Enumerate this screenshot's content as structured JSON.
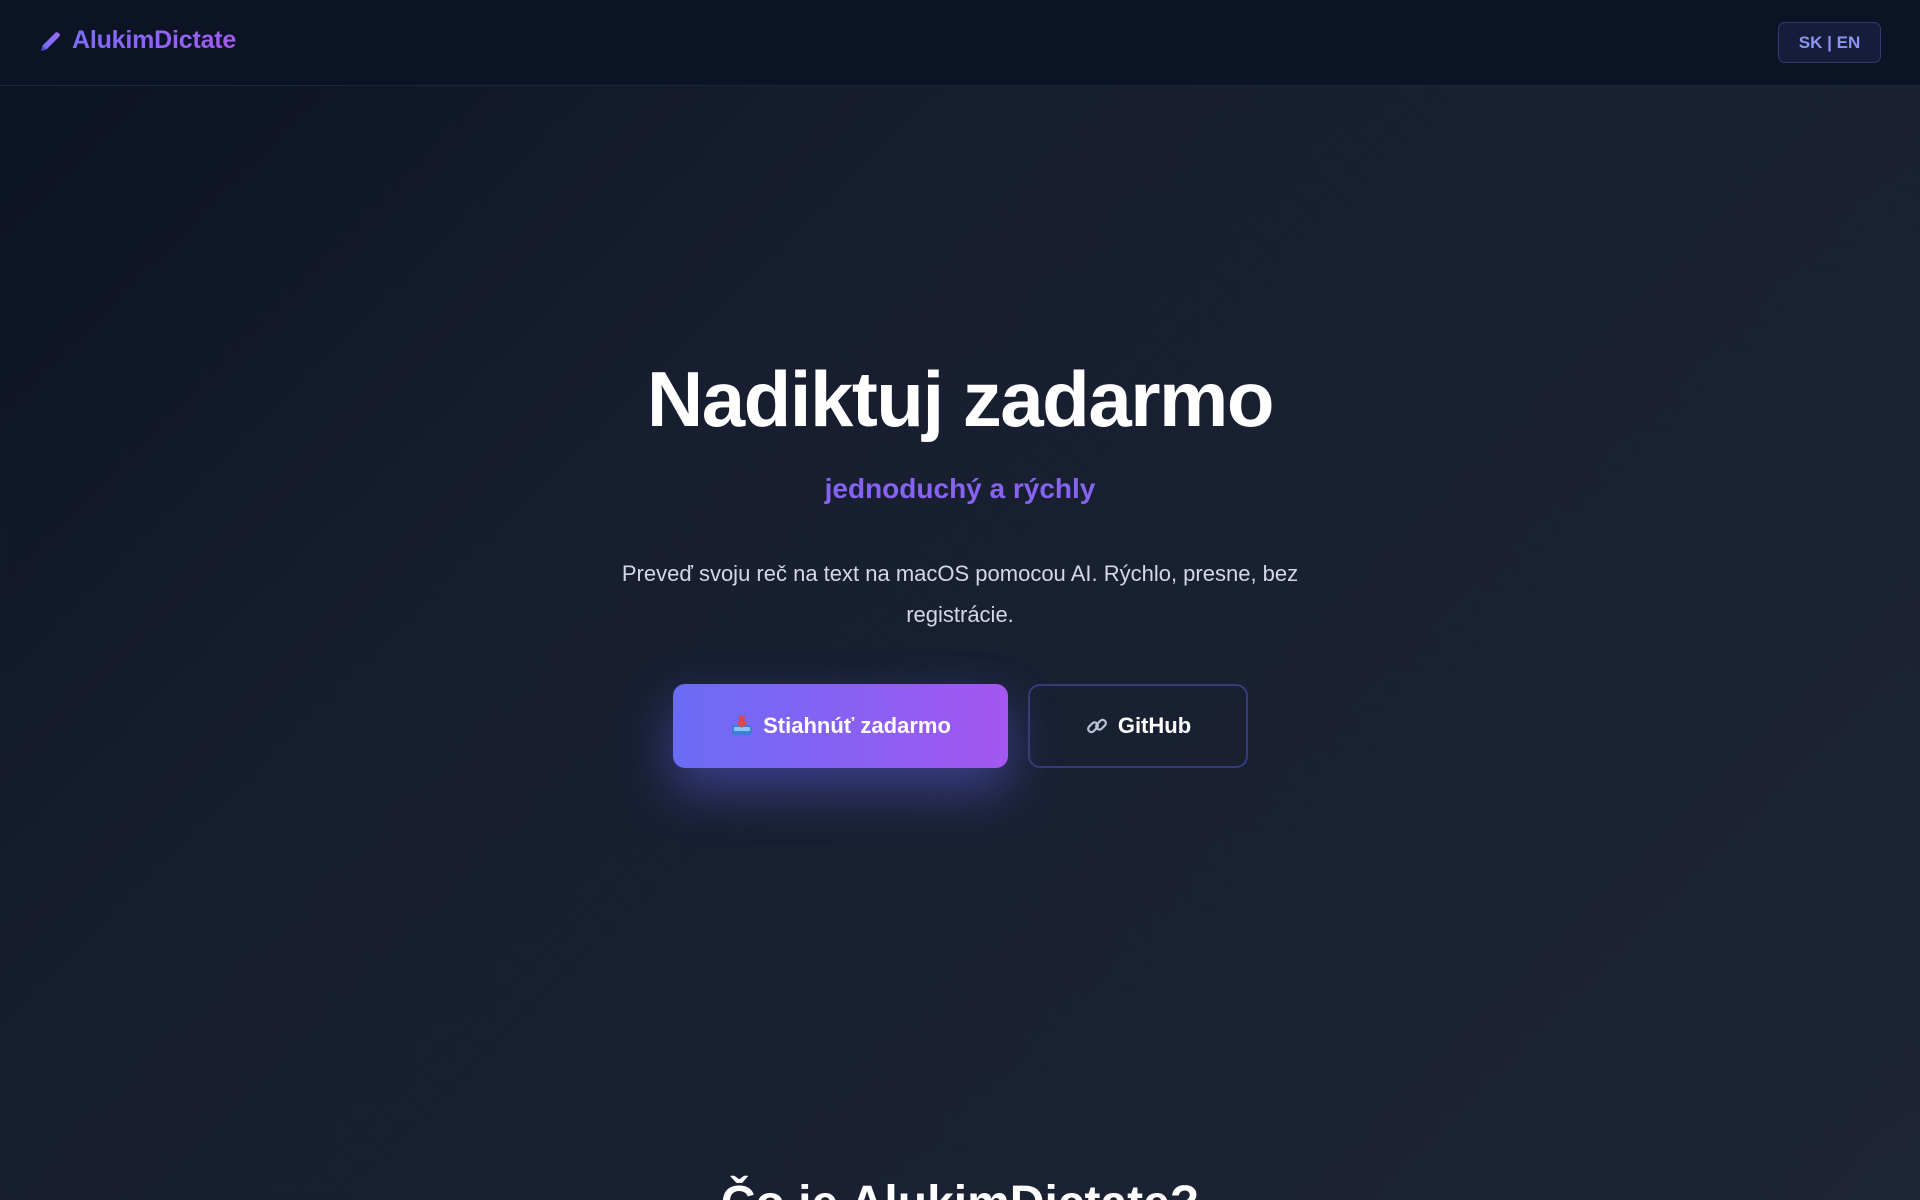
{
  "navbar": {
    "brand_name": "AlukimDictate",
    "brand_icon": "pencil-icon",
    "lang_toggle": "SK | EN"
  },
  "hero": {
    "title": "Nadiktuj zadarmo",
    "subtitle": "jednoduchý a rýchly",
    "description": "Preveď svoju reč na text na macOS pomocou AI. Rýchlo, presne, bez registrácie.",
    "download_button": {
      "icon": "inbox-tray-icon",
      "label": "Stiahnúť zadarmo"
    },
    "github_button": {
      "icon": "link-icon",
      "label": "GitHub"
    }
  },
  "next_section": {
    "title_partial": "Čo je AlukimDictate?"
  },
  "colors": {
    "background": "#171e30",
    "navbar": "#0b1324",
    "accent_start": "#6a6cf5",
    "accent_end": "#a457f0",
    "subtitle": "#8663f0",
    "lang_toggle_text": "#8c95f0"
  }
}
